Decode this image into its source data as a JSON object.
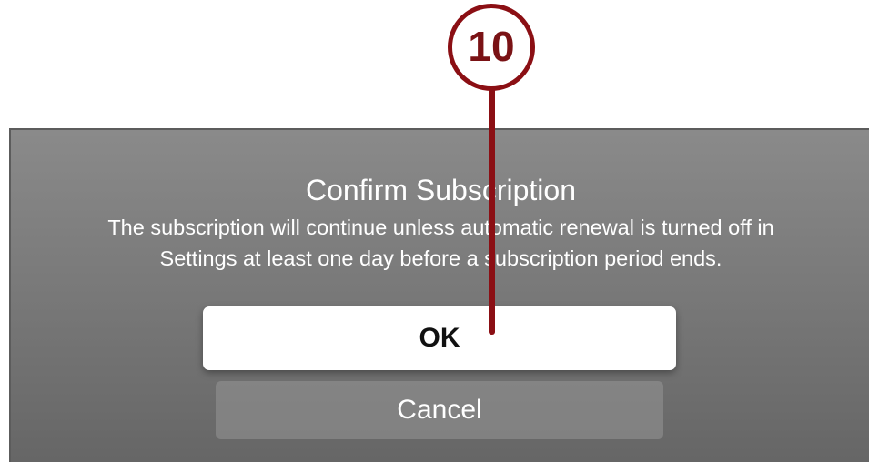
{
  "dialog": {
    "title": "Confirm Subscription",
    "message_line1": "The subscription will continue unless automatic renewal is turned off in",
    "message_line2": "Settings at least one day before a subscription period ends.",
    "ok_label": "OK",
    "cancel_label": "Cancel"
  },
  "callout": {
    "number": "10",
    "color": "#8b0f14"
  },
  "colors": {
    "screen_background": "#7a7a7a",
    "ok_button": "#ffffff",
    "text": "#ffffff"
  }
}
